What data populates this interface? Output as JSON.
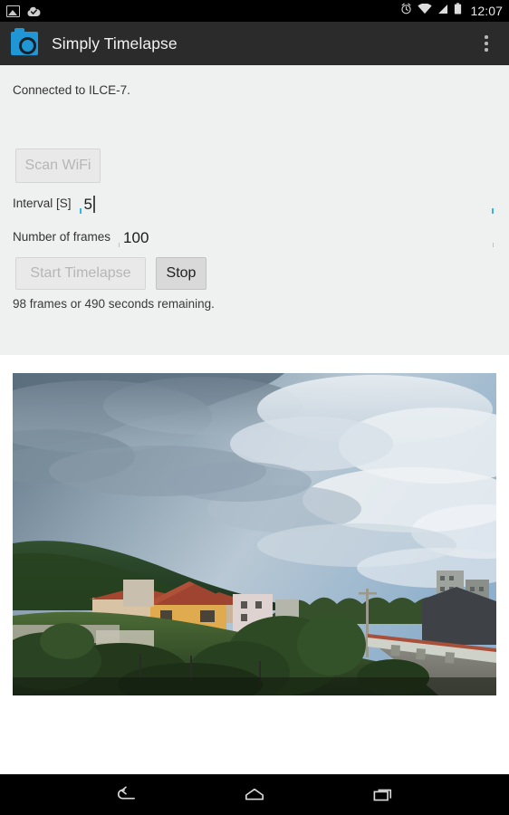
{
  "status_bar": {
    "time": "12:07",
    "icons": [
      "screenshot-image-icon",
      "download-complete-icon",
      "alarm-icon",
      "wifi-icon",
      "signal-icon",
      "battery-icon"
    ]
  },
  "app_bar": {
    "icon": "camera-app-icon",
    "title": "Simply Timelapse",
    "overflow_menu": "overflow-menu-icon"
  },
  "main": {
    "connection_status": "Connected to ILCE-7.",
    "scan_wifi_label": "Scan WiFi",
    "scan_wifi_enabled": false,
    "interval": {
      "label": "Interval [S]",
      "value": "5",
      "focused": true
    },
    "frames": {
      "label": "Number of frames",
      "value": "100",
      "focused": false
    },
    "start_label": "Start Timelapse",
    "start_enabled": false,
    "stop_label": "Stop",
    "stop_enabled": true,
    "remaining_text": "98 frames or 490 seconds remaining."
  },
  "preview": {
    "name": "timelapse-photo-preview",
    "description": "Village landscape with cloudy sky, forested hill, yellow house with red roof, green vegetation and dirt road"
  },
  "nav_bar": {
    "back": "back-icon",
    "home": "home-icon",
    "recents": "recents-icon"
  },
  "colors": {
    "accent": "#33b5e5",
    "app_bar": "#2b2b2b",
    "content_bg": "#eff0f0",
    "app_icon": "#2196d4"
  }
}
